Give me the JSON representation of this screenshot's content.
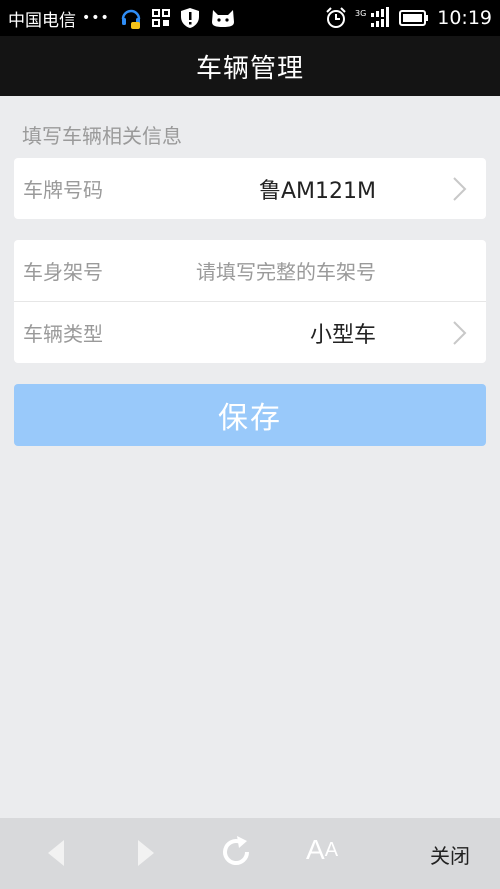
{
  "status_bar": {
    "carrier": "中国电信",
    "dots": "•••",
    "network": "3G",
    "time": "10:19"
  },
  "header": {
    "title": "车辆管理"
  },
  "form": {
    "section_label": "填写车辆相关信息",
    "plate": {
      "label": "车牌号码",
      "value": "鲁AM121M"
    },
    "vin": {
      "label": "车身架号",
      "placeholder": "请填写完整的车架号"
    },
    "type": {
      "label": "车辆类型",
      "value": "小型车"
    }
  },
  "save_button": {
    "label": "保存"
  },
  "bottom_toolbar": {
    "font_label": "A",
    "font_label_small": "A",
    "close_label": "关闭"
  },
  "colors": {
    "accent": "#99c9fa",
    "background": "#ebecee",
    "header": "#141414"
  }
}
